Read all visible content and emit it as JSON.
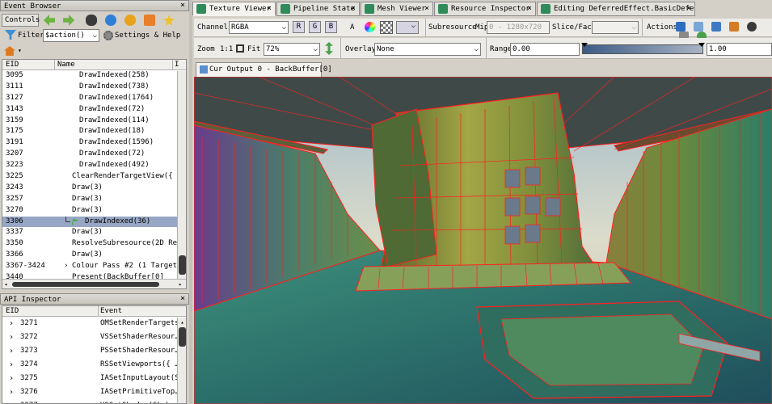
{
  "event_browser": {
    "title": "Event Browser",
    "controls_label": "Controls",
    "filter_label": "Filter",
    "filter_value": "$action()",
    "settings_label": "Settings & Help",
    "col_eid": "EID",
    "col_name": "Name",
    "rows": [
      {
        "eid": "3095",
        "name": "DrawIndexed(258)",
        "indent": 2
      },
      {
        "eid": "3111",
        "name": "DrawIndexed(738)",
        "indent": 2
      },
      {
        "eid": "3127",
        "name": "DrawIndexed(1764)",
        "indent": 2
      },
      {
        "eid": "3143",
        "name": "DrawIndexed(72)",
        "indent": 2
      },
      {
        "eid": "3159",
        "name": "DrawIndexed(114)",
        "indent": 2
      },
      {
        "eid": "3175",
        "name": "DrawIndexed(18)",
        "indent": 2
      },
      {
        "eid": "3191",
        "name": "DrawIndexed(1596)",
        "indent": 2
      },
      {
        "eid": "3207",
        "name": "DrawIndexed(72)",
        "indent": 2
      },
      {
        "eid": "3223",
        "name": "DrawIndexed(492)",
        "indent": 2
      },
      {
        "eid": "3225",
        "name": "ClearRenderTargetView({ …",
        "indent": 0
      },
      {
        "eid": "3243",
        "name": "Draw(3)",
        "indent": 0
      },
      {
        "eid": "3257",
        "name": "Draw(3)",
        "indent": 0
      },
      {
        "eid": "3270",
        "name": "Draw(3)",
        "indent": 0
      },
      {
        "eid": "3306",
        "name": "DrawIndexed(36)",
        "indent": 1,
        "selected": true
      },
      {
        "eid": "3337",
        "name": "Draw(3)",
        "indent": 0
      },
      {
        "eid": "3350",
        "name": "ResolveSubresource(2D Ren",
        "indent": 0
      },
      {
        "eid": "3366",
        "name": "Draw(3)",
        "indent": 0
      },
      {
        "eid": "3367-3424",
        "name": "Colour Pass #2 (1 Targets)",
        "indent": 0,
        "expand": true
      },
      {
        "eid": "3440",
        "name": "Present(BackBuffer[0]",
        "indent": 0
      }
    ]
  },
  "api_inspector": {
    "title": "API Inspector",
    "col_eid": "EID",
    "col_event": "Event",
    "rows": [
      {
        "eid": "3271",
        "event": "OMSetRenderTargets({"
      },
      {
        "eid": "3272",
        "event": "VSSetShaderResour…"
      },
      {
        "eid": "3273",
        "event": "PSSetShaderResour…"
      },
      {
        "eid": "3274",
        "event": "RSSetViewports({ …"
      },
      {
        "eid": "3275",
        "event": "IASetInputLayout(Sk"
      },
      {
        "eid": "3276",
        "event": "IASetPrimitiveTop…"
      },
      {
        "eid": "3277",
        "event": "VSSetShader(Skybo"
      }
    ]
  },
  "tabs": [
    {
      "label": "Texture Viewer",
      "active": true
    },
    {
      "label": "Pipeline State"
    },
    {
      "label": "Mesh Viewer"
    },
    {
      "label": "Resource Inspector"
    },
    {
      "label": "Editing DeferredEffect.BasicDefer…"
    }
  ],
  "toolbar": {
    "channels_label": "Channels",
    "channels_value": "RGBA",
    "r": "R",
    "g": "G",
    "b": "B",
    "a": "A",
    "subresource_label": "Subresource",
    "mip_label": "Mip",
    "mip_value": "0 - 1280x720",
    "slice_label": "Slice/Face",
    "actions_label": "Actions",
    "zoom_label": "Zoom",
    "zoom_1to1": "1:1",
    "fit_label": "Fit",
    "zoom_value": "72%",
    "overlay_label": "Overlay",
    "overlay_value": "None",
    "range_label": "Range",
    "range_min": "0.00",
    "range_max": "1.00"
  },
  "output_tab": "Cur Output 0 - BackBuffer[0]",
  "colors": {
    "selection": "#97a6c4",
    "tab_icon": "#2f8c5a",
    "wireframe": "#ff2020"
  }
}
